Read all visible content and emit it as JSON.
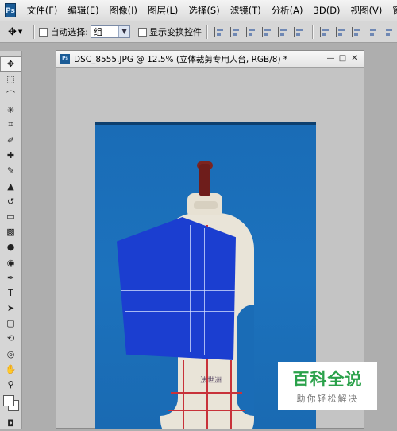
{
  "app": {
    "logo_text": "Ps"
  },
  "menu": [
    "文件(F)",
    "编辑(E)",
    "图像(I)",
    "图层(L)",
    "选择(S)",
    "滤镜(T)",
    "分析(A)",
    "3D(D)",
    "视图(V)",
    "窗口("
  ],
  "options": {
    "auto_select_label": "自动选择:",
    "auto_select_value": "组",
    "show_transform_label": "显示变换控件"
  },
  "tools": [
    {
      "name": "move-tool",
      "glyph": "✥"
    },
    {
      "name": "marquee-tool",
      "glyph": "⬚"
    },
    {
      "name": "lasso-tool",
      "glyph": "⌒"
    },
    {
      "name": "magic-wand-tool",
      "glyph": "✳"
    },
    {
      "name": "crop-tool",
      "glyph": "⌗"
    },
    {
      "name": "eyedropper-tool",
      "glyph": "✐"
    },
    {
      "name": "healing-brush-tool",
      "glyph": "✚"
    },
    {
      "name": "brush-tool",
      "glyph": "✎"
    },
    {
      "name": "clone-stamp-tool",
      "glyph": "▲"
    },
    {
      "name": "history-brush-tool",
      "glyph": "↺"
    },
    {
      "name": "eraser-tool",
      "glyph": "▭"
    },
    {
      "name": "gradient-tool",
      "glyph": "▩"
    },
    {
      "name": "blur-tool",
      "glyph": "●"
    },
    {
      "name": "dodge-tool",
      "glyph": "◉"
    },
    {
      "name": "pen-tool",
      "glyph": "✒"
    },
    {
      "name": "type-tool",
      "glyph": "T"
    },
    {
      "name": "path-selection-tool",
      "glyph": "➤"
    },
    {
      "name": "shape-tool",
      "glyph": "▢"
    },
    {
      "name": "3d-rotate-tool",
      "glyph": "⟲"
    },
    {
      "name": "3d-orbit-tool",
      "glyph": "◎"
    },
    {
      "name": "hand-tool",
      "glyph": "✋"
    },
    {
      "name": "zoom-tool",
      "glyph": "⚲"
    }
  ],
  "document": {
    "title": "DSC_8555.JPG @ 12.5% (立体裁剪专用人台, RGB/8) *"
  },
  "photo": {
    "brand_text": "法世洲"
  },
  "watermark": {
    "title": "百科全说",
    "subtitle": "助你轻松解决"
  },
  "colors": {
    "canvas_blue": "#1a6cb6",
    "cloth_blue": "#1b3ed0",
    "watermark_green": "#2aa14a"
  }
}
